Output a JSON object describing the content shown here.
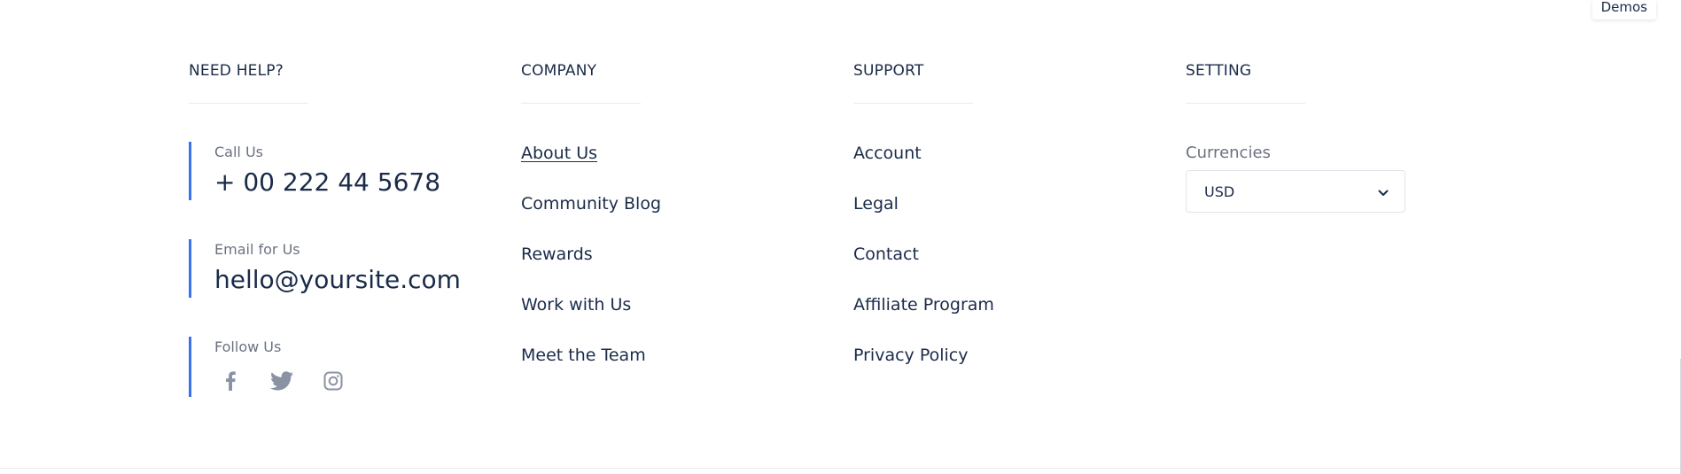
{
  "demos_tab": {
    "label": "Demos"
  },
  "help": {
    "title": "NEED HELP?",
    "call": {
      "label": "Call Us",
      "value": "+ 00 222 44 5678"
    },
    "email": {
      "label": "Email for Us",
      "value": "hello@yoursite.com"
    },
    "follow": {
      "label": "Follow Us",
      "icons": [
        "facebook-icon",
        "twitter-icon",
        "instagram-icon"
      ]
    }
  },
  "company": {
    "title": "COMPANY",
    "links": [
      "About Us",
      "Community Blog",
      "Rewards",
      "Work with Us",
      "Meet the Team"
    ]
  },
  "support": {
    "title": "SUPPORT",
    "links": [
      "Account",
      "Legal",
      "Contact",
      "Affiliate Program",
      "Privacy Policy"
    ]
  },
  "setting": {
    "title": "SETTING",
    "currencies_label": "Currencies",
    "currency_selected": "USD"
  },
  "colors": {
    "accent": "#3b71e8",
    "text": "#1a2b49",
    "muted": "#6b7280",
    "icon": "#8a93a3"
  }
}
